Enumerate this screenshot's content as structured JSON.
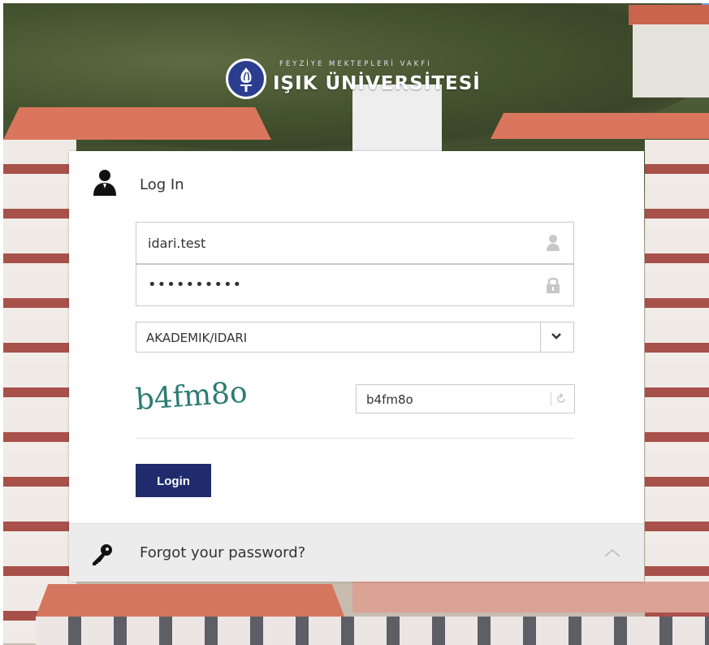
{
  "branding": {
    "foundation_text": "FEYZİYE MEKTEPLERİ VAKFI",
    "university_name": "IŞIK ÜNİVERSİTESİ",
    "emblem_icon": "torch-emblem-icon"
  },
  "login": {
    "title": "Log In",
    "username_value": "idari.test",
    "password_masked": "••••••••••",
    "role_selected": "AKADEMIK/IDARI",
    "captcha_image_text": "b4fm8o",
    "captcha_value": "b4fm8o",
    "submit_label": "Login"
  },
  "forgot": {
    "label": "Forgot your password?"
  },
  "colors": {
    "button_bg": "#1f2b6d",
    "brand_blue": "#2a3d8f",
    "panel_gray": "#ececec"
  }
}
